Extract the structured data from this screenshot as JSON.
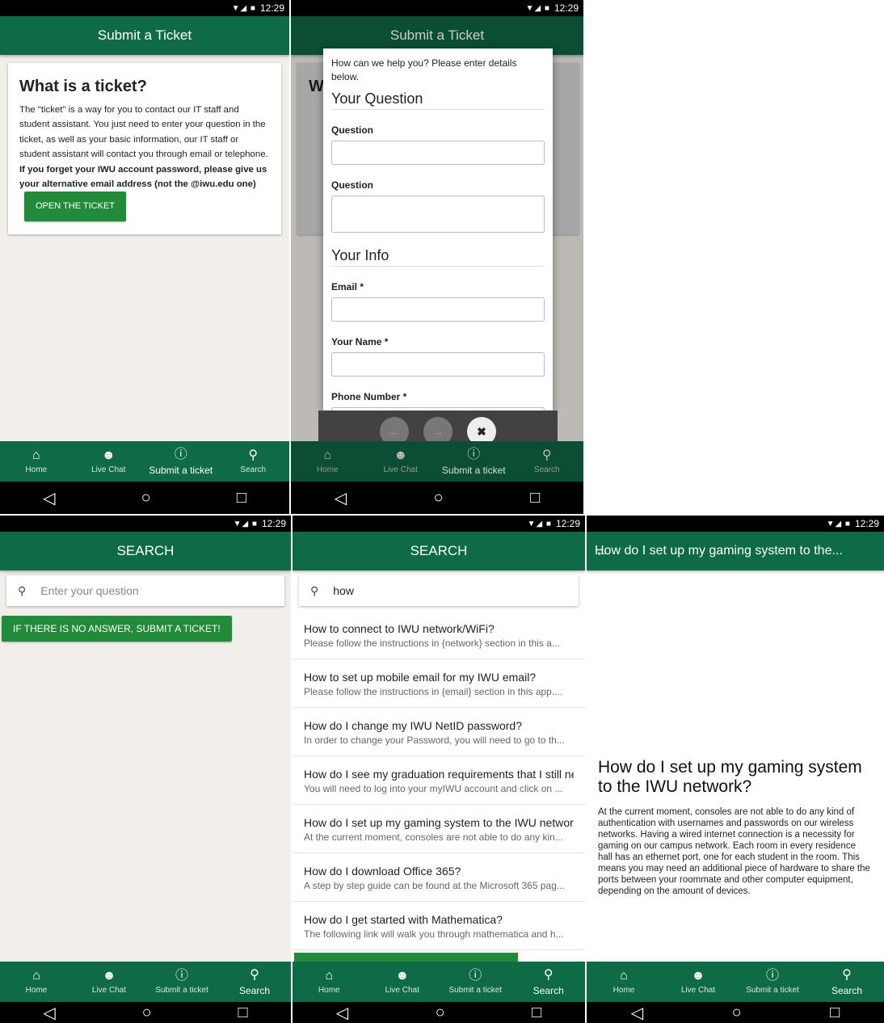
{
  "status": {
    "time": "12:29",
    "icons": "▼◢ ■"
  },
  "nav": {
    "home": "Home",
    "chat": "Live Chat",
    "ticket": "Submit a ticket",
    "search": "Search"
  },
  "sysnav": {
    "back": "◁",
    "home": "○",
    "recent": "□"
  },
  "screen1": {
    "title": "Submit a Ticket",
    "heading": "What is a ticket?",
    "body": "The \"ticket\" is a way for you to contact our IT staff and student assistant. You just need to enter your question in the ticket, as well as your basic information, our IT staff or student assistant will contact you through email or telephone. ",
    "bold": "If you forget your IWU account password, please give us your alternative email address (not the @iwu.edu one)",
    "button": "OPEN THE TICKET"
  },
  "screen2": {
    "title": "Submit a Ticket",
    "bg_heading": "W",
    "intro": "How can we help you? Please enter details below.",
    "section_question": "Your Question",
    "label_question_1": "Question",
    "label_question_2": "Question",
    "section_info": "Your Info",
    "label_email": "Email *",
    "label_name": "Your Name *",
    "label_phone": "Phone Number *",
    "ctrl_prev": "←",
    "ctrl_next": "→",
    "ctrl_close": "✖"
  },
  "screen3": {
    "title": "SEARCH",
    "placeholder": "Enter your question",
    "submit": "IF THERE IS NO ANSWER, SUBMIT A TICKET!"
  },
  "screen4": {
    "title": "SEARCH",
    "query": "how",
    "results": [
      {
        "title": "How to connect to IWU network/WiFi?",
        "desc": "Please follow the instructions in {network} section in this a..."
      },
      {
        "title": "How to set up mobile email for my IWU email?",
        "desc": "Please follow the instructions in {email} section in this app...."
      },
      {
        "title": "How do I change my IWU NetID password?",
        "desc": "In order to change your Password, you will need to go to th..."
      },
      {
        "title": "How do I see my graduation requirements that I still ne",
        "desc": "You will need to log into your myIWU account and click on ..."
      },
      {
        "title": "How do I set up my gaming system to the IWU networ",
        "desc": "At the current moment, consoles are not able to do any kin..."
      },
      {
        "title": "How do I download Office 365?",
        "desc": "A step by step guide can be found at the Microsoft 365 pag..."
      },
      {
        "title": "How do I get started with Mathematica?",
        "desc": "The following link will walk you through mathematica and h..."
      }
    ]
  },
  "screen5": {
    "title": "How do I set up my gaming system to the...",
    "heading": "How do I set up my gaming system to the IWU network?",
    "body": "At the current moment, consoles are not able to do any kind of authentication with usernames and passwords on our wireless networks. Having a wired internet connection is a necessity for gaming on our campus network. Each room in every residence hall has an ethernet port, one for each student in the room. This means you may need an additional piece of hardware to share the ports between your roommate and other computer equipment, depending on the amount of devices."
  },
  "colors": {
    "brand": "#0e6b45",
    "button": "#228b3a",
    "background": "#f2efea"
  }
}
